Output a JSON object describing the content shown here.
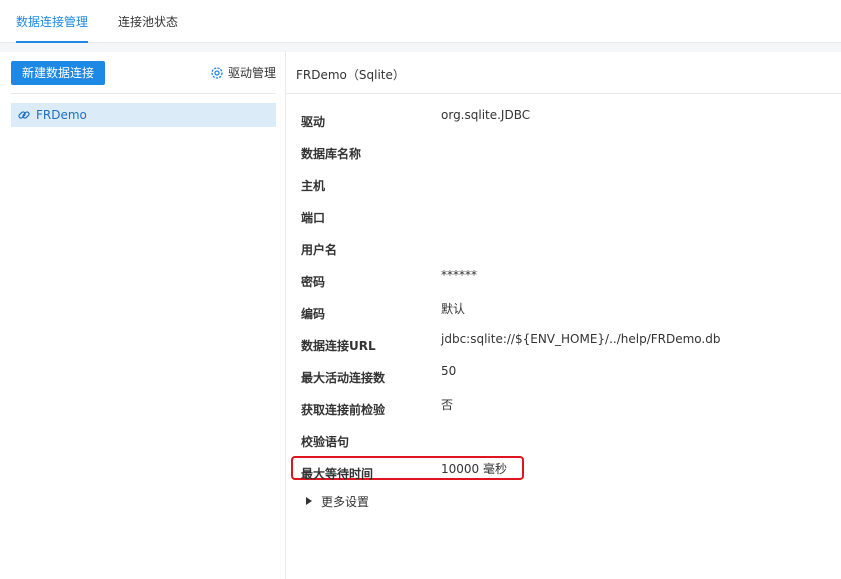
{
  "tabs": [
    {
      "label": "数据连接管理",
      "active": true
    },
    {
      "label": "连接池状态",
      "active": false
    }
  ],
  "sidebar": {
    "new_button": "新建数据连接",
    "driver_manage": "驱动管理",
    "connections": [
      {
        "label": "FRDemo",
        "selected": true
      }
    ]
  },
  "main": {
    "title": "FRDemo（Sqlite）",
    "fields": [
      {
        "label": "驱动",
        "value": "org.sqlite.JDBC"
      },
      {
        "label": "数据库名称",
        "value": ""
      },
      {
        "label": "主机",
        "value": ""
      },
      {
        "label": "端口",
        "value": ""
      },
      {
        "label": "用户名",
        "value": ""
      },
      {
        "label": "密码",
        "value": "******"
      },
      {
        "label": "编码",
        "value": "默认"
      },
      {
        "label": "数据连接URL",
        "value": "jdbc:sqlite://${ENV_HOME}/../help/FRDemo.db"
      },
      {
        "label": "最大活动连接数",
        "value": "50"
      },
      {
        "label": "获取连接前检验",
        "value": "否"
      },
      {
        "label": "校验语句",
        "value": ""
      },
      {
        "label": "最大等待时间",
        "value": "10000 毫秒"
      }
    ],
    "more_settings": "更多设置"
  },
  "colors": {
    "accent": "#1e88e5",
    "highlight_border": "#e0141e",
    "selected_bg": "#dcebf8"
  }
}
